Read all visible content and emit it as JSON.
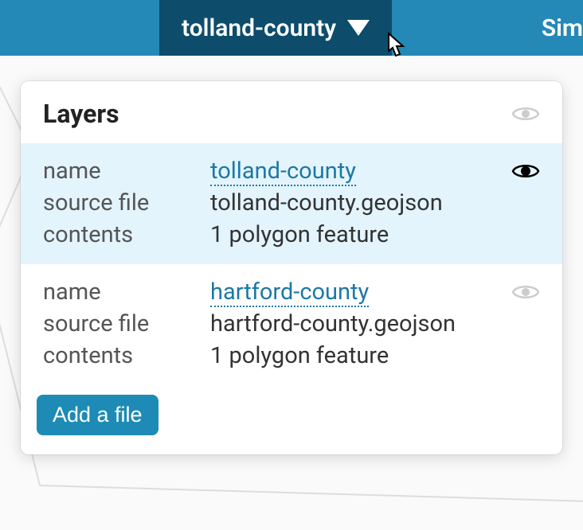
{
  "topbar": {
    "current_tab": "tolland-county",
    "right_text": "Sim"
  },
  "panel": {
    "title": "Layers",
    "labels": {
      "name": "name",
      "source": "source file",
      "contents": "contents"
    },
    "add_button": "Add a file"
  },
  "layers": [
    {
      "name": "tolland-county",
      "source": "tolland-county.geojson",
      "contents": "1 polygon feature",
      "visible": true,
      "active": true
    },
    {
      "name": "hartford-county",
      "source": "hartford-county.geojson",
      "contents": "1 polygon feature",
      "visible": false,
      "active": false
    }
  ]
}
